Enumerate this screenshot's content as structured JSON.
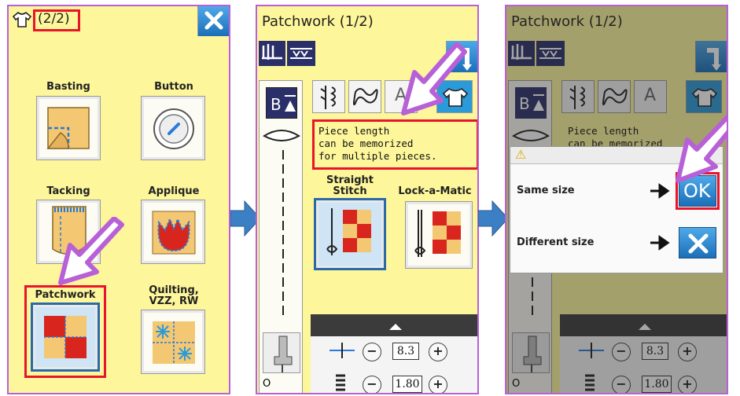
{
  "panel1": {
    "title": "(2/2)",
    "close_label": "×",
    "items": [
      {
        "label": "Basting",
        "icon": "basting-icon"
      },
      {
        "label": "Button",
        "icon": "button-icon"
      },
      {
        "label": "Tacking",
        "icon": "tacking-icon"
      },
      {
        "label": "Applique",
        "icon": "applique-icon"
      },
      {
        "label": "Patchwork",
        "icon": "patchwork-icon"
      },
      {
        "label": "Quilting,\nVZZ, RW",
        "icon": "quilting-icon"
      }
    ]
  },
  "panel2": {
    "title": "Patchwork  (1/2)",
    "message_line1": "Piece length",
    "message_line2": "can be memorized",
    "message_line3": "for multiple pieces.",
    "stitch1_label_1": "Straight",
    "stitch1_label_2": "Stitch",
    "stitch2_label": "Lock-a-Matic",
    "length_value": "8.3",
    "width_value": "1.80",
    "o_label": "O",
    "letter_tab": "A"
  },
  "panel3": {
    "title": "Patchwork  (1/2)",
    "message_line1": "Piece length",
    "message_line2": "can be memorized",
    "dialog_warning": "⚠",
    "same_size": "Same size",
    "different_size": "Different size",
    "ok_label": "OK",
    "cancel_label": "×",
    "length_value": "8.3",
    "width_value": "1.80",
    "o_label": "O",
    "letter_tab": "A"
  },
  "colors": {
    "panel_bg": "#fdf69b",
    "panel_border": "#b760d8",
    "highlight_red": "#e8142a",
    "accent_blue": "#1b6fb8",
    "callout_arrow": "#b760d8",
    "flow_arrow": "#3b7fc4"
  }
}
